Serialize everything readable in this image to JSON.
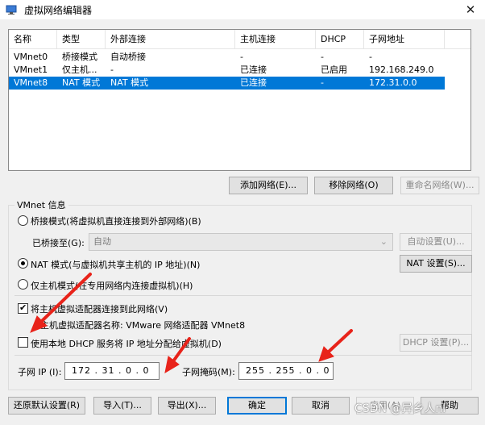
{
  "window": {
    "title": "虚拟网络编辑器",
    "close_glyph": "✕"
  },
  "table": {
    "headers": [
      "名称",
      "类型",
      "外部连接",
      "主机连接",
      "DHCP",
      "子网地址"
    ],
    "rows": [
      [
        "VMnet0",
        "桥接模式",
        "自动桥接",
        "-",
        "-",
        "-"
      ],
      [
        "VMnet1",
        "仅主机...",
        "-",
        "已连接",
        "已启用",
        "192.168.249.0"
      ],
      [
        "VMnet8",
        "NAT 模式",
        "NAT 模式",
        "已连接",
        "-",
        "172.31.0.0"
      ]
    ],
    "selected_row": 2
  },
  "table_buttons": {
    "add": "添加网络(E)...",
    "remove": "移除网络(O)",
    "rename": "重命名网络(W)..."
  },
  "vmnet_info": {
    "group_label": "VMnet 信息",
    "bridge_radio": "桥接模式(将虚拟机直接连接到外部网络)(B)",
    "bridged_to_label": "已桥接至(G):",
    "bridged_to_value": "自动",
    "auto_settings": "自动设置(U)...",
    "nat_radio": "NAT 模式(与虚拟机共享主机的 IP 地址)(N)",
    "nat_settings": "NAT 设置(S)...",
    "hostonly_radio": "仅主机模式(在专用网络内连接虚拟机)(H)",
    "connect_adapter_check": "将主机虚拟适配器连接到此网络(V)",
    "adapter_name_text": "主机虚拟适配器名称: VMware 网络适配器 VMnet8",
    "dhcp_check": "使用本地 DHCP 服务将 IP 地址分配给虚拟机(D)",
    "dhcp_settings": "DHCP 设置(P)...",
    "subnet_ip_label": "子网 IP (I):",
    "subnet_ip_value": "172 . 31 . 0 . 0",
    "subnet_mask_label": "子网掩码(M):",
    "subnet_mask_value": "255 . 255 . 0 . 0"
  },
  "bottom_buttons": {
    "restore": "还原默认设置(R)",
    "import": "导入(T)...",
    "export": "导出(X)...",
    "ok": "确定",
    "cancel": "取消",
    "apply": "应用(A)",
    "help": "帮助"
  },
  "state": {
    "selected_mode": "nat",
    "connect_adapter": true,
    "use_dhcp": false
  },
  "watermark": "CSDN @异乡人nl",
  "colors": {
    "selection": "#0078d7",
    "arrow": "#e8231a"
  }
}
